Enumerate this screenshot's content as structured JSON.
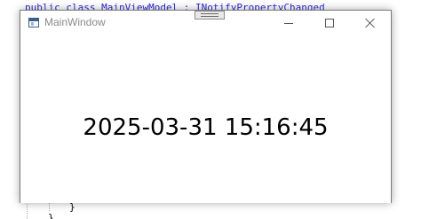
{
  "background_editor": {
    "code_line_top": "public class MainViewModel : INotifyPropertyChanged",
    "brace_1": "}",
    "brace_2": "}"
  },
  "window": {
    "title": "MainWindow",
    "icon": "app-window-icon",
    "caption_buttons": {
      "minimize_icon": "minimize-icon",
      "maximize_icon": "maximize-icon",
      "close_icon": "close-icon"
    },
    "debug_toolbar_icon": "debug-toolbar-grip-icon"
  },
  "content": {
    "datetime_text": "2025-03-31 15:16:45"
  },
  "colors": {
    "code_keyword": "#2b2bd6",
    "title_text": "#8a8a8a",
    "window_border": "#7a7a7a",
    "caption_glyph": "#555555"
  }
}
